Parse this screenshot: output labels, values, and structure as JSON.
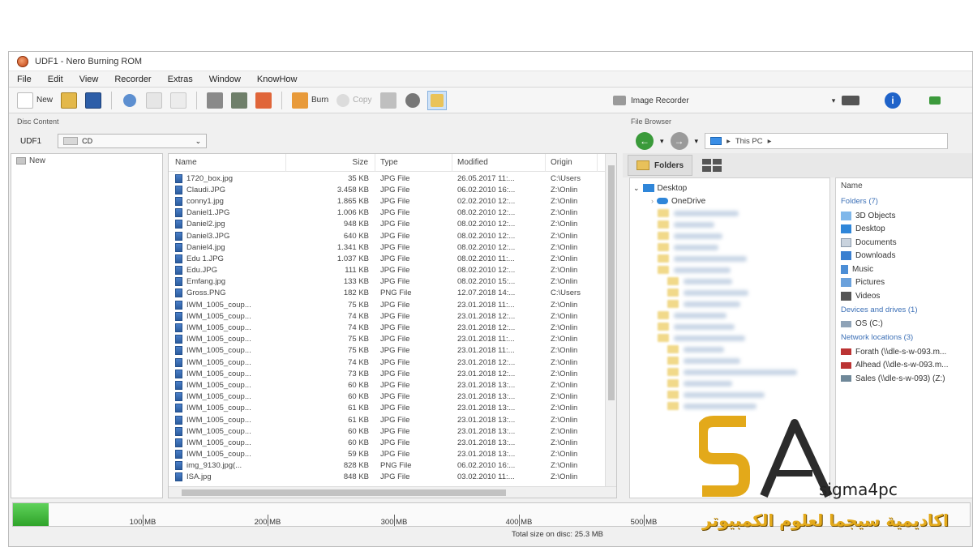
{
  "window": {
    "title": "UDF1 - Nero Burning ROM"
  },
  "menu": [
    "File",
    "Edit",
    "View",
    "Recorder",
    "Extras",
    "Window",
    "KnowHow"
  ],
  "toolbar": {
    "new_label": "New",
    "burn_label": "Burn",
    "copy_label": "Copy",
    "recorder_label": "Image Recorder"
  },
  "disc_content": {
    "header": "Disc Content",
    "disc_label": "UDF1",
    "disc_type": "CD",
    "tree_root": "New",
    "columns": {
      "name": "Name",
      "size": "Size",
      "type": "Type",
      "modified": "Modified",
      "origin": "Origin"
    },
    "files": [
      {
        "name": "1720_box.jpg",
        "size": "35 KB",
        "type": "JPG File",
        "modified": "26.05.2017 11:...",
        "origin": "C:\\Users"
      },
      {
        "name": "Claudi.JPG",
        "size": "3.458 KB",
        "type": "JPG File",
        "modified": "06.02.2010 16:...",
        "origin": "Z:\\Onlin"
      },
      {
        "name": "conny1.jpg",
        "size": "1.865 KB",
        "type": "JPG File",
        "modified": "02.02.2010 12:...",
        "origin": "Z:\\Onlin"
      },
      {
        "name": "Daniel1.JPG",
        "size": "1.006 KB",
        "type": "JPG File",
        "modified": "08.02.2010 12:...",
        "origin": "Z:\\Onlin"
      },
      {
        "name": "Daniel2.jpg",
        "size": "948 KB",
        "type": "JPG File",
        "modified": "08.02.2010 12:...",
        "origin": "Z:\\Onlin"
      },
      {
        "name": "Daniel3.JPG",
        "size": "640 KB",
        "type": "JPG File",
        "modified": "08.02.2010 12:...",
        "origin": "Z:\\Onlin"
      },
      {
        "name": "Daniel4.jpg",
        "size": "1.341 KB",
        "type": "JPG File",
        "modified": "08.02.2010 12:...",
        "origin": "Z:\\Onlin"
      },
      {
        "name": "Edu 1.JPG",
        "size": "1.037 KB",
        "type": "JPG File",
        "modified": "08.02.2010 11:...",
        "origin": "Z:\\Onlin"
      },
      {
        "name": "Edu.JPG",
        "size": "111 KB",
        "type": "JPG File",
        "modified": "08.02.2010 12:...",
        "origin": "Z:\\Onlin"
      },
      {
        "name": "Emfang.jpg",
        "size": "133 KB",
        "type": "JPG File",
        "modified": "08.02.2010 15:...",
        "origin": "Z:\\Onlin"
      },
      {
        "name": "Gross.PNG",
        "size": "182 KB",
        "type": "PNG File",
        "modified": "12.07.2018 14:...",
        "origin": "C:\\Users"
      },
      {
        "name": "IWM_1005_coup...",
        "size": "75 KB",
        "type": "JPG File",
        "modified": "23.01.2018 11:...",
        "origin": "Z:\\Onlin"
      },
      {
        "name": "IWM_1005_coup...",
        "size": "74 KB",
        "type": "JPG File",
        "modified": "23.01.2018 12:...",
        "origin": "Z:\\Onlin"
      },
      {
        "name": "IWM_1005_coup...",
        "size": "74 KB",
        "type": "JPG File",
        "modified": "23.01.2018 12:...",
        "origin": "Z:\\Onlin"
      },
      {
        "name": "IWM_1005_coup...",
        "size": "75 KB",
        "type": "JPG File",
        "modified": "23.01.2018 11:...",
        "origin": "Z:\\Onlin"
      },
      {
        "name": "IWM_1005_coup...",
        "size": "75 KB",
        "type": "JPG File",
        "modified": "23.01.2018 11:...",
        "origin": "Z:\\Onlin"
      },
      {
        "name": "IWM_1005_coup...",
        "size": "74 KB",
        "type": "JPG File",
        "modified": "23.01.2018 12:...",
        "origin": "Z:\\Onlin"
      },
      {
        "name": "IWM_1005_coup...",
        "size": "73 KB",
        "type": "JPG File",
        "modified": "23.01.2018 12:...",
        "origin": "Z:\\Onlin"
      },
      {
        "name": "IWM_1005_coup...",
        "size": "60 KB",
        "type": "JPG File",
        "modified": "23.01.2018 13:...",
        "origin": "Z:\\Onlin"
      },
      {
        "name": "IWM_1005_coup...",
        "size": "60 KB",
        "type": "JPG File",
        "modified": "23.01.2018 13:...",
        "origin": "Z:\\Onlin"
      },
      {
        "name": "IWM_1005_coup...",
        "size": "61 KB",
        "type": "JPG File",
        "modified": "23.01.2018 13:...",
        "origin": "Z:\\Onlin"
      },
      {
        "name": "IWM_1005_coup...",
        "size": "61 KB",
        "type": "JPG File",
        "modified": "23.01.2018 13:...",
        "origin": "Z:\\Onlin"
      },
      {
        "name": "IWM_1005_coup...",
        "size": "60 KB",
        "type": "JPG File",
        "modified": "23.01.2018 13:...",
        "origin": "Z:\\Onlin"
      },
      {
        "name": "IWM_1005_coup...",
        "size": "60 KB",
        "type": "JPG File",
        "modified": "23.01.2018 13:...",
        "origin": "Z:\\Onlin"
      },
      {
        "name": "IWM_1005_coup...",
        "size": "59 KB",
        "type": "JPG File",
        "modified": "23.01.2018 13:...",
        "origin": "Z:\\Onlin"
      },
      {
        "name": "img_9130.jpg(...",
        "size": "828 KB",
        "type": "PNG File",
        "modified": "06.02.2010 16:...",
        "origin": "Z:\\Onlin"
      },
      {
        "name": "ISA.jpg",
        "size": "848 KB",
        "type": "JPG File",
        "modified": "03.02.2010 11:...",
        "origin": "Z:\\Onlin"
      }
    ]
  },
  "file_browser": {
    "header": "File Browser",
    "address": "This PC",
    "folders_tab": "Folders",
    "tree": [
      {
        "label": "Desktop"
      },
      {
        "label": "OneDrive"
      }
    ],
    "view_header": "Name",
    "groups": [
      {
        "title": "Folders (7)",
        "items": [
          "3D Objects",
          "Desktop",
          "Documents",
          "Downloads",
          "Music",
          "Pictures",
          "Videos"
        ]
      },
      {
        "title": "Devices and drives (1)",
        "items": [
          "OS (C:)"
        ]
      },
      {
        "title": "Network locations (3)",
        "items": [
          "Forath (\\\\dle-s-w-093.m...",
          "Alhead (\\\\dle-s-w-093.m...",
          "Sales (\\\\dle-s-w-093) (Z:)"
        ]
      }
    ]
  },
  "capacity_bar": {
    "used_fraction": 0.037,
    "ticks": [
      "100 MB",
      "200 MB",
      "300 MB",
      "400 MB",
      "500 MB"
    ],
    "total_text": "Total size on disc: 25.3 MB"
  },
  "overlay_logo": {
    "brand": "sigma4pc",
    "arabic": "اكاديمية سيجما لعلوم الكمبيوتر",
    "colors": {
      "gold": "#e3a91a",
      "dark": "#2b2b2b"
    }
  },
  "colors": {
    "accent_green": "#2fa32a",
    "file_icon_blue": "#2c5c9e",
    "group_blue": "#3b6fb6"
  }
}
